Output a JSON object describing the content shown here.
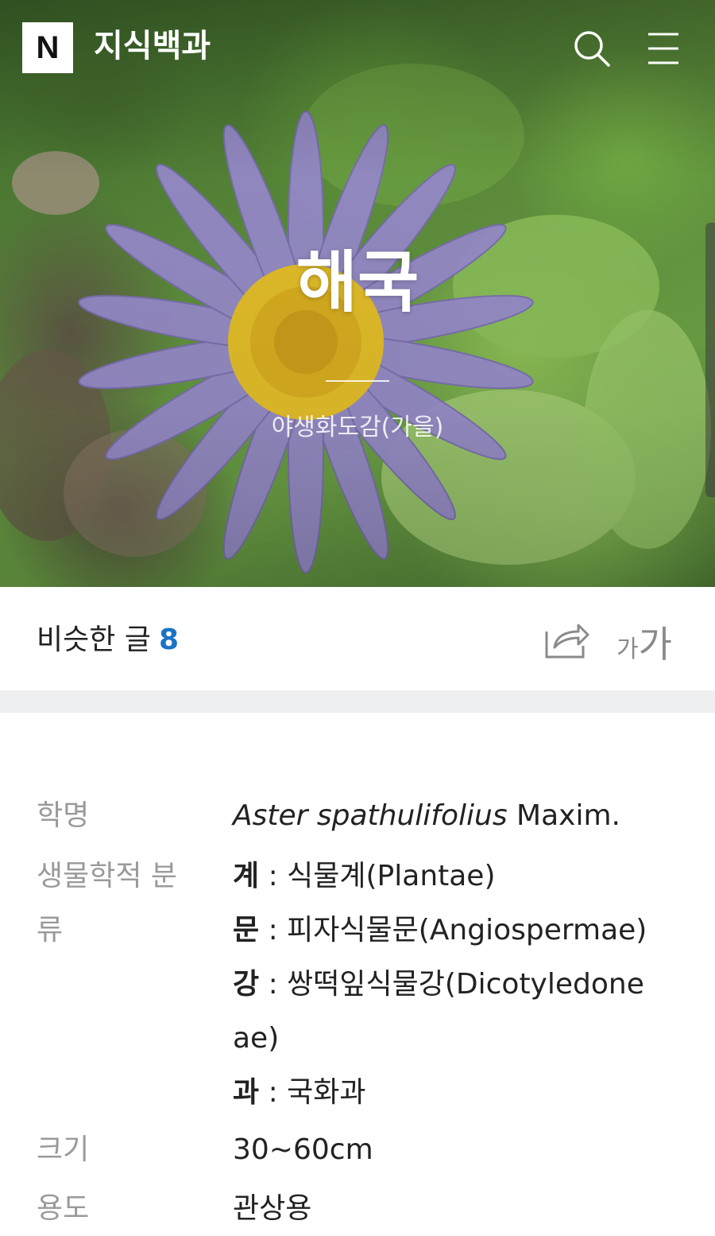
{
  "header": {
    "logo_letter": "N",
    "brand": "지식백과",
    "search_icon": "search-icon",
    "menu_icon": "hamburger-menu-icon"
  },
  "hero": {
    "title": "해국",
    "subtitle": "야생화도감(가을)"
  },
  "actions": {
    "similar_label": "비슷한 글",
    "similar_count": "8",
    "share_icon": "share-icon",
    "font_size_small": "가",
    "font_size_big": "가"
  },
  "info": {
    "scientific_name": {
      "label": "학명",
      "italic": "Aster spathulifolius",
      "author": " Maxim."
    },
    "classification": {
      "label_line1": "생물학적 분",
      "label_line2": "류",
      "kingdom": {
        "rank": "계",
        "sep": " : ",
        "value": "식물계(Plantae)"
      },
      "division": {
        "rank": "문",
        "sep": " : ",
        "value": "피자식물문(Angiospermae)"
      },
      "class_line1": {
        "rank": "강",
        "sep": " : ",
        "value": "쌍떡잎식물강(Dicotyledone"
      },
      "class_line2": "ae)",
      "family": {
        "rank": "과",
        "sep": " : ",
        "value": "국화과"
      }
    },
    "size": {
      "label": "크기",
      "value": "30~60cm"
    },
    "usage": {
      "label": "용도",
      "value": "관상용"
    }
  },
  "colors": {
    "accent_count": "#1a73c7",
    "label_gray": "#9a9a9a",
    "divider_band": "#eeeff1"
  }
}
